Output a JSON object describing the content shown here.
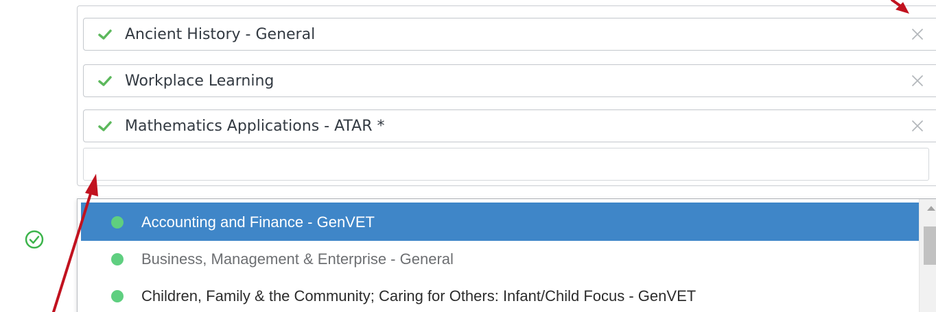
{
  "selected_tags": [
    {
      "label": "Ancient History - General",
      "check_icon": "check-icon",
      "remove_icon": "close-icon"
    },
    {
      "label": "Workplace Learning",
      "check_icon": "check-icon",
      "remove_icon": "close-icon"
    },
    {
      "label": "Mathematics Applications - ATAR *",
      "check_icon": "check-icon",
      "remove_icon": "close-icon"
    }
  ],
  "search": {
    "value": "",
    "placeholder": ""
  },
  "dropdown": {
    "options": [
      {
        "label": "Accounting and Finance - GenVET",
        "highlighted": true
      },
      {
        "label": "Business, Management & Enterprise - General",
        "highlighted": false
      },
      {
        "label": "Children, Family & the Community; Caring for Others: Infant/Child Focus - GenVET",
        "highlighted": false
      }
    ]
  },
  "validation_icon": "check-circle-icon",
  "annotation_arrows": [
    "arrow-to-remove-icon",
    "arrow-to-search-input"
  ],
  "colors": {
    "check": "#5cb85c",
    "status_dot": "#5fcf80",
    "highlight": "#3f86c8",
    "annotation_arrow": "#c1121f",
    "valid_icon": "#3cb44b"
  }
}
